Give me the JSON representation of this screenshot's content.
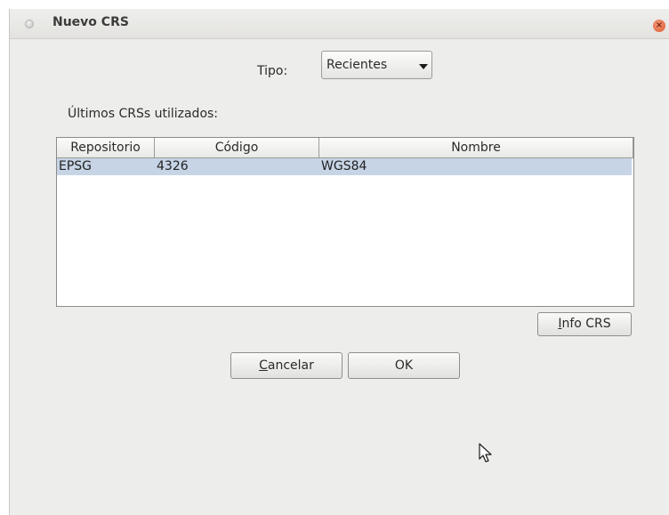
{
  "window": {
    "title": "Nuevo CRS",
    "close_glyph": "×"
  },
  "tipo": {
    "label": "Tipo:",
    "selected": "Recientes"
  },
  "recent_label": "Últimos CRSs utilizados:",
  "table": {
    "columns": [
      "Repositorio",
      "Código",
      "Nombre"
    ],
    "rows": [
      {
        "repositorio": "EPSG",
        "codigo": "4326",
        "nombre": "WGS84"
      }
    ]
  },
  "buttons": {
    "info": {
      "mnemonic": "I",
      "rest": "nfo CRS"
    },
    "cancel": {
      "mnemonic": "C",
      "rest": "ancelar"
    },
    "ok": "OK"
  },
  "icons": {
    "window_menu": "window-menu-icon",
    "close": "close-icon",
    "dropdown": "chevron-down-icon",
    "cursor": "mouse-pointer-icon"
  },
  "colors": {
    "close_button": "#dc5a2e",
    "selected_row": "#c6d4e6",
    "dialog_bg": "#ededeb"
  }
}
